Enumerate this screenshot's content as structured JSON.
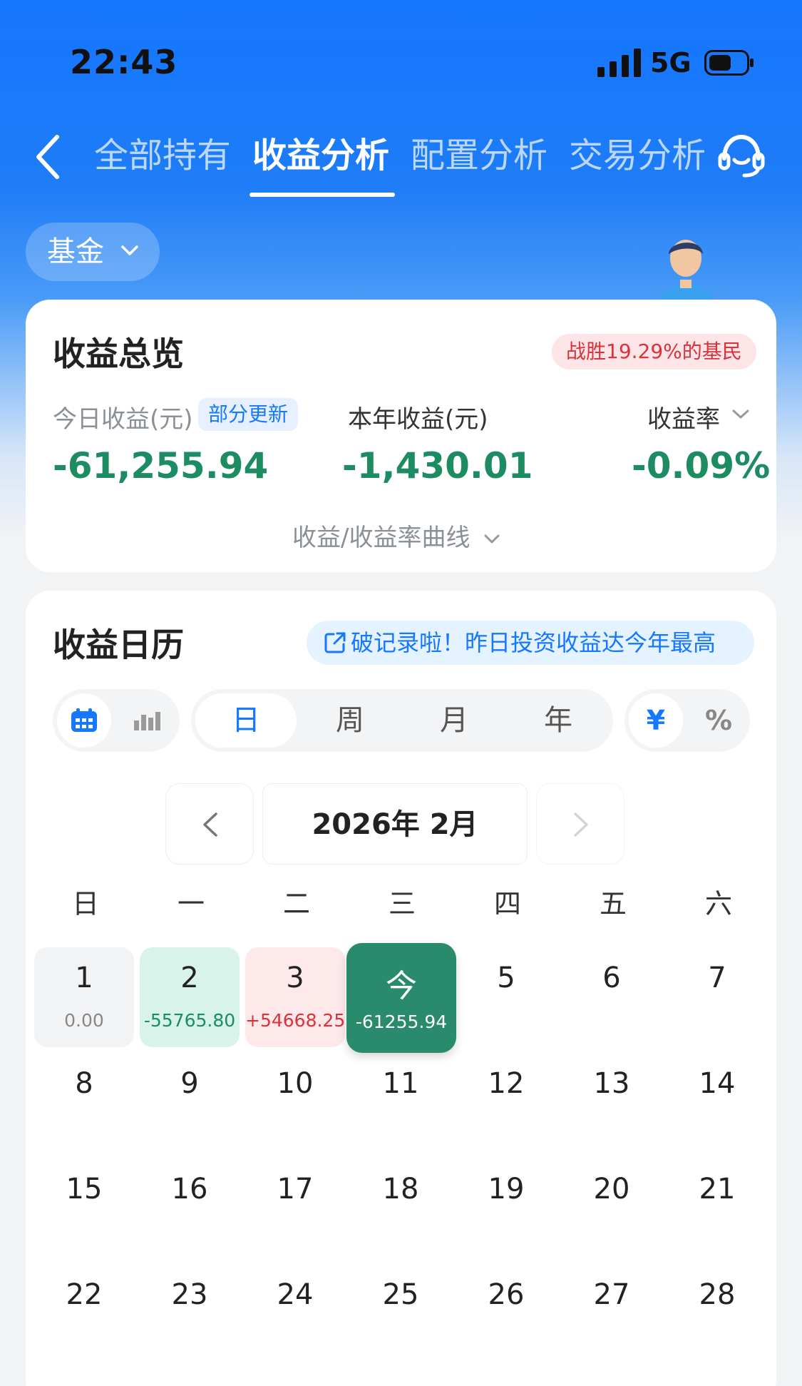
{
  "status_bar": {
    "time": "22:43",
    "network": "5G"
  },
  "nav": {
    "tabs": [
      {
        "label": "全部持有"
      },
      {
        "label": "收益分析"
      },
      {
        "label": "配置分析"
      },
      {
        "label": "交易分析"
      }
    ],
    "active_tab": "收益分析"
  },
  "filter": {
    "fund_label": "基金"
  },
  "overview": {
    "title": "收益总览",
    "beat_badge": "战胜19.29%的基民",
    "today": {
      "label": "今日收益(元)",
      "badge": "部分更新",
      "value": "-61,255.94"
    },
    "year": {
      "label": "本年收益(元)",
      "value": "-1,430.01"
    },
    "rate": {
      "label": "收益率",
      "value": "-0.09%"
    },
    "curve_link": "收益/收益率曲线"
  },
  "calendar": {
    "title": "收益日历",
    "record_banner": "破记录啦！昨日投资收益达今年最高",
    "periods": [
      "日",
      "周",
      "月",
      "年"
    ],
    "active_period": "日",
    "units": [
      "¥",
      "%"
    ],
    "active_unit": "¥",
    "month_label": "2026年 2月",
    "weekdays": [
      "日",
      "一",
      "二",
      "三",
      "四",
      "五",
      "六"
    ],
    "days": [
      {
        "day": "1",
        "amount": "0.00",
        "status": "zero"
      },
      {
        "day": "2",
        "amount": "-55765.80",
        "status": "down"
      },
      {
        "day": "3",
        "amount": "+54668.25",
        "status": "up"
      },
      {
        "day": "今",
        "amount": "-61255.94",
        "status": "today"
      },
      {
        "day": "5"
      },
      {
        "day": "6"
      },
      {
        "day": "7"
      },
      {
        "day": "8"
      },
      {
        "day": "9"
      },
      {
        "day": "10"
      },
      {
        "day": "11"
      },
      {
        "day": "12"
      },
      {
        "day": "13"
      },
      {
        "day": "14"
      },
      {
        "day": "15"
      },
      {
        "day": "16"
      },
      {
        "day": "17"
      },
      {
        "day": "18"
      },
      {
        "day": "19"
      },
      {
        "day": "20"
      },
      {
        "day": "21"
      },
      {
        "day": "22"
      },
      {
        "day": "23"
      },
      {
        "day": "24"
      },
      {
        "day": "25"
      },
      {
        "day": "26"
      },
      {
        "day": "27"
      },
      {
        "day": "28"
      }
    ]
  },
  "colors": {
    "brand_blue": "#1677ff",
    "loss_green": "#1d8c63",
    "gain_red": "#d9343b",
    "today_green": "#2a8a6c"
  },
  "icons": [
    "back-icon",
    "customer-service-icon",
    "chevron-down-icon",
    "external-link-icon",
    "calendar-icon",
    "bar-chart-icon",
    "chevron-left-icon",
    "chevron-right-icon"
  ]
}
